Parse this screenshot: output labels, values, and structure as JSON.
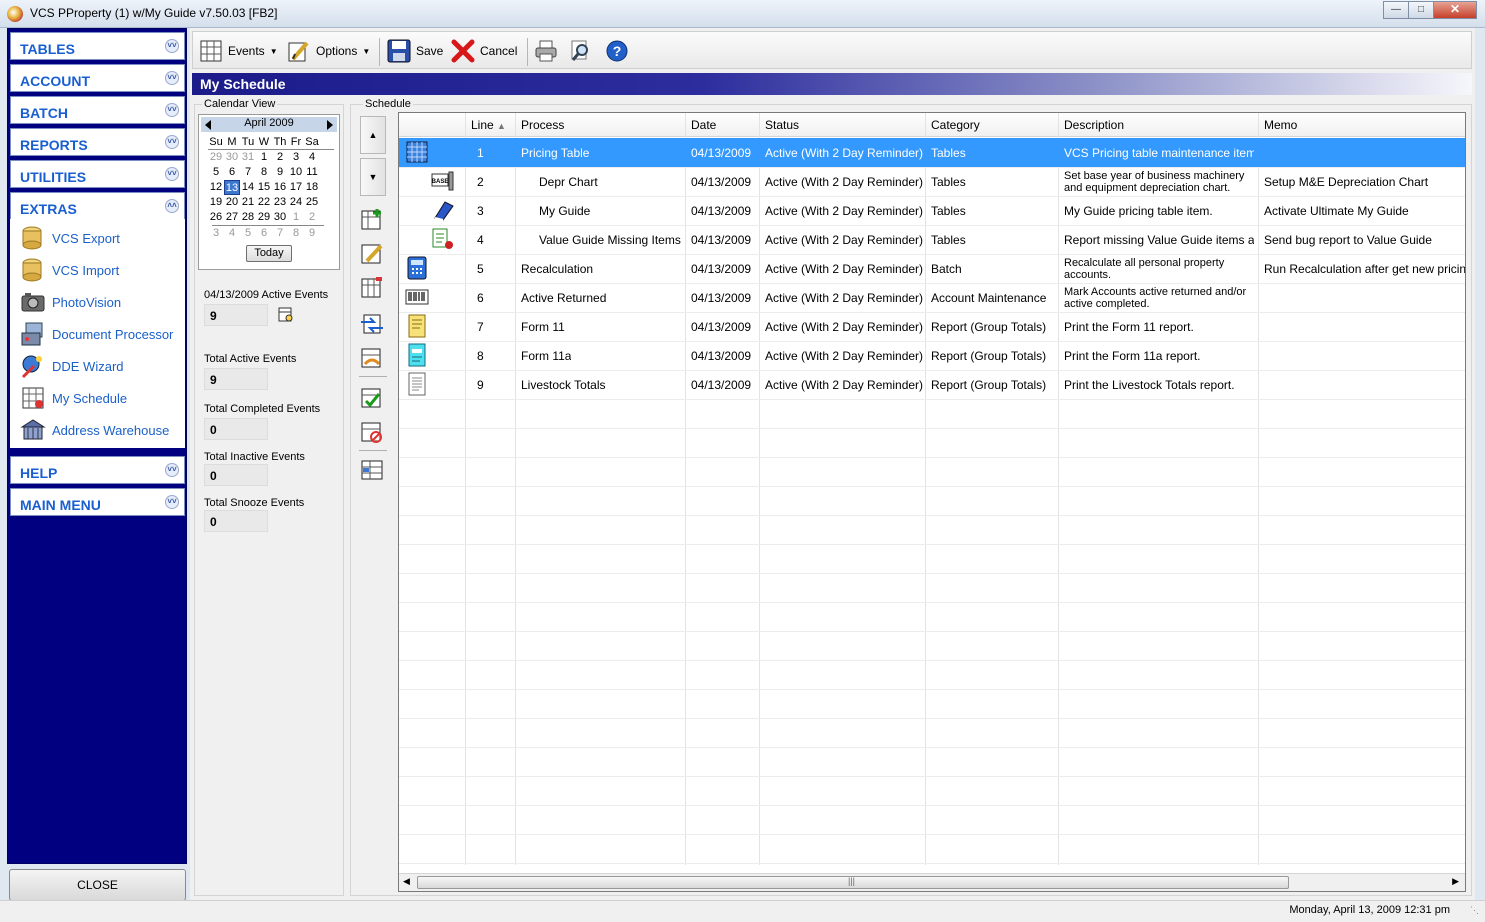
{
  "window": {
    "title": "VCS PProperty (1) w/My Guide v7.50.03 [FB2]"
  },
  "sidebar": {
    "sections": [
      {
        "label": "TABLES"
      },
      {
        "label": "ACCOUNT"
      },
      {
        "label": "BATCH"
      },
      {
        "label": "REPORTS"
      },
      {
        "label": "UTILITIES"
      },
      {
        "label": "EXTRAS"
      },
      {
        "label": "HELP"
      },
      {
        "label": "MAIN MENU"
      }
    ],
    "extras_items": [
      {
        "label": "VCS Export",
        "icon": "database-export-icon"
      },
      {
        "label": "VCS Import",
        "icon": "database-import-icon"
      },
      {
        "label": "PhotoVision",
        "icon": "camera-icon"
      },
      {
        "label": "Document Processor",
        "icon": "document-processor-icon"
      },
      {
        "label": "DDE Wizard",
        "icon": "wizard-icon"
      },
      {
        "label": "My Schedule",
        "icon": "schedule-icon"
      },
      {
        "label": "Address Warehouse",
        "icon": "warehouse-icon"
      }
    ],
    "close_label": "CLOSE"
  },
  "toolbar": {
    "events_label": "Events",
    "options_label": "Options",
    "save_label": "Save",
    "cancel_label": "Cancel"
  },
  "page_title": "My Schedule",
  "calendar": {
    "group_label": "Calendar View",
    "month_label": "April 2009",
    "weekdays": [
      "Su",
      "M",
      "Tu",
      "W",
      "Th",
      "Fr",
      "Sa"
    ],
    "weeks": [
      [
        "29",
        "30",
        "31",
        "1",
        "2",
        "3",
        "4"
      ],
      [
        "5",
        "6",
        "7",
        "8",
        "9",
        "10",
        "11"
      ],
      [
        "12",
        "13",
        "14",
        "15",
        "16",
        "17",
        "18"
      ],
      [
        "19",
        "20",
        "21",
        "22",
        "23",
        "24",
        "25"
      ],
      [
        "26",
        "27",
        "28",
        "29",
        "30",
        "1",
        "2"
      ],
      [
        "3",
        "4",
        "5",
        "6",
        "7",
        "8",
        "9"
      ]
    ],
    "selected_day": "13",
    "today_label": "Today"
  },
  "stats": {
    "active_events_label": "04/13/2009 Active Events",
    "active_events_value": "9",
    "total_active_label": "Total Active Events",
    "total_active_value": "9",
    "total_completed_label": "Total Completed Events",
    "total_completed_value": "0",
    "total_inactive_label": "Total Inactive Events",
    "total_inactive_value": "0",
    "total_snooze_label": "Total Snooze Events",
    "total_snooze_value": "0"
  },
  "schedule": {
    "group_label": "Schedule",
    "columns": [
      "Line",
      "Process",
      "Date",
      "Status",
      "Category",
      "Description",
      "Memo"
    ],
    "rows": [
      {
        "line": "1",
        "process": "Pricing Table",
        "date": "04/13/2009",
        "status": "Active (With 2 Day Reminder)",
        "category": "Tables",
        "description": "VCS Pricing table maintenance item.",
        "memo": "",
        "icon": "grid-table-icon",
        "indent": false
      },
      {
        "line": "2",
        "process": "Depr Chart",
        "date": "04/13/2009",
        "status": "Active (With 2 Day Reminder)",
        "category": "Tables",
        "description": "Set base year of business machinery and equipment depreciation chart.",
        "memo": "Setup M&E Depreciation Chart",
        "icon": "base-chart-icon",
        "indent": true
      },
      {
        "line": "3",
        "process": "My Guide",
        "date": "04/13/2009",
        "status": "Active (With 2 Day Reminder)",
        "category": "Tables",
        "description": "My Guide pricing table item.",
        "memo": "Activate Ultimate My Guide",
        "icon": "guide-book-icon",
        "indent": true
      },
      {
        "line": "4",
        "process": "Value Guide Missing Items",
        "date": "04/13/2009",
        "status": "Active (With 2 Day Reminder)",
        "category": "Tables",
        "description": "Report missing Value Guide items and...",
        "memo": "Send bug report to Value Guide",
        "icon": "bug-report-icon",
        "indent": true
      },
      {
        "line": "5",
        "process": "Recalculation",
        "date": "04/13/2009",
        "status": "Active (With 2 Day Reminder)",
        "category": "Batch",
        "description": "Recalculate all personal property accounts.",
        "memo": "Run Recalculation after get new pricing gu",
        "icon": "calculator-icon",
        "indent": false
      },
      {
        "line": "6",
        "process": "Active Returned",
        "date": "04/13/2009",
        "status": "Active (With 2 Day Reminder)",
        "category": "Account Maintenance",
        "description": "Mark Accounts active returned and/or active completed.",
        "memo": "",
        "icon": "barcode-icon",
        "indent": false
      },
      {
        "line": "7",
        "process": "Form 11",
        "date": "04/13/2009",
        "status": "Active (With 2 Day Reminder)",
        "category": "Report (Group Totals)",
        "description": "Print the Form 11 report.",
        "memo": "",
        "icon": "form-icon",
        "indent": false
      },
      {
        "line": "8",
        "process": "Form 11a",
        "date": "04/13/2009",
        "status": "Active (With 2 Day Reminder)",
        "category": "Report (Group Totals)",
        "description": "Print the Form 11a report.",
        "memo": "",
        "icon": "form-cyan-icon",
        "indent": false
      },
      {
        "line": "9",
        "process": "Livestock Totals",
        "date": "04/13/2009",
        "status": "Active (With 2 Day Reminder)",
        "category": "Report (Group Totals)",
        "description": "Print the Livestock Totals report.",
        "memo": "",
        "icon": "report-page-icon",
        "indent": false
      }
    ]
  },
  "statusbar": {
    "datetime": "Monday, April 13, 2009  12:31 pm"
  }
}
